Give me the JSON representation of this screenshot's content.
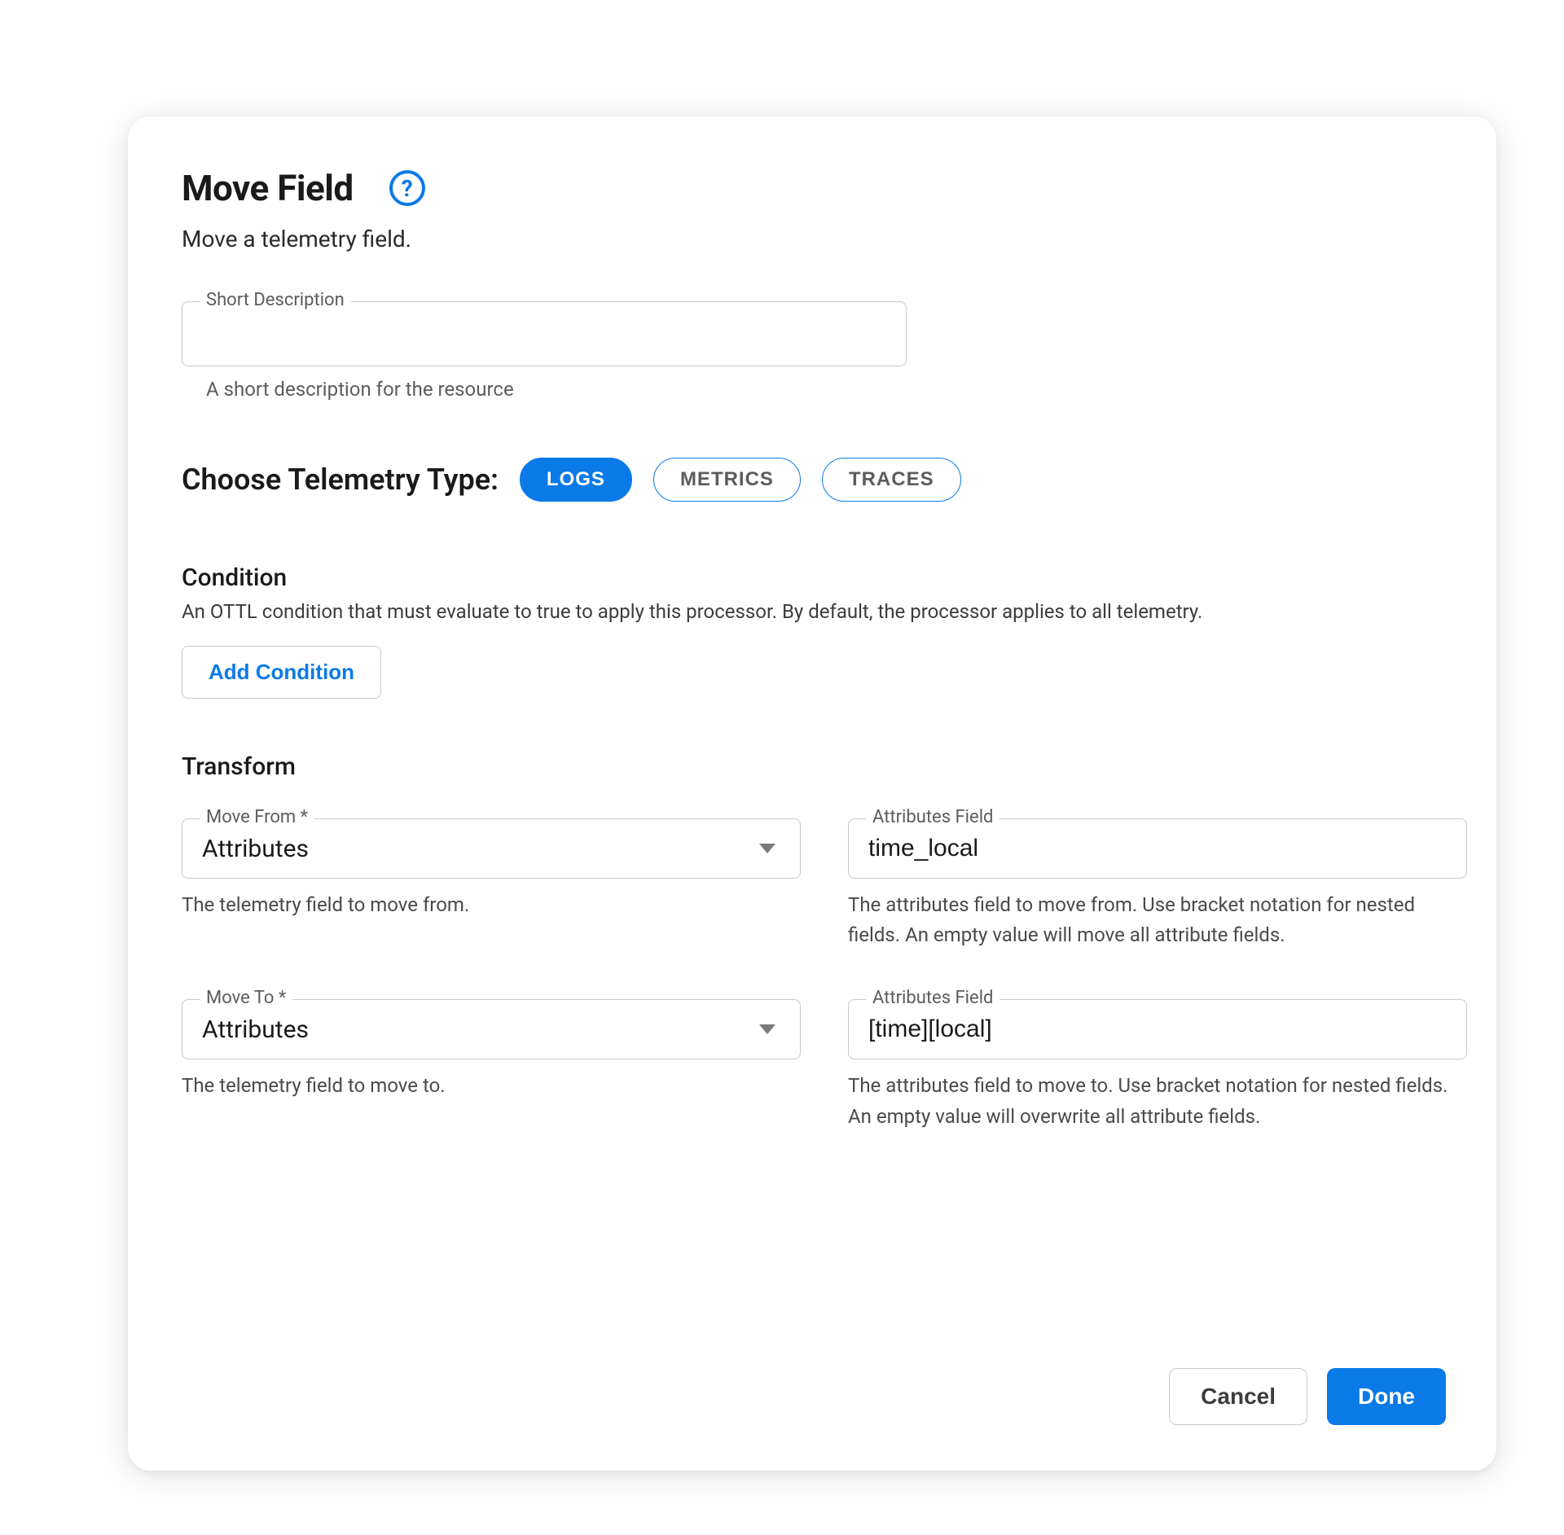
{
  "dialog": {
    "title": "Move Field",
    "subtitle": "Move a telemetry field.",
    "help_icon": "?"
  },
  "shortDescription": {
    "label": "Short Description",
    "value": "",
    "helper": "A short description for the resource"
  },
  "telemetryType": {
    "label": "Choose Telemetry Type:",
    "options": {
      "logs": "LOGS",
      "metrics": "METRICS",
      "traces": "TRACES"
    },
    "active": "logs"
  },
  "condition": {
    "title": "Condition",
    "description": "An OTTL condition that must evaluate to true to apply this processor. By default, the processor applies to all telemetry.",
    "addButton": "Add Condition"
  },
  "transform": {
    "title": "Transform",
    "moveFrom": {
      "label": "Move From *",
      "value": "Attributes",
      "helper": "The telemetry field to move from."
    },
    "attrFrom": {
      "label": "Attributes Field",
      "value": "time_local",
      "helper": "The attributes field to move from. Use bracket notation for nested fields. An empty value will move all attribute fields."
    },
    "moveTo": {
      "label": "Move To *",
      "value": "Attributes",
      "helper": "The telemetry field to move to."
    },
    "attrTo": {
      "label": "Attributes Field",
      "value": "[time][local]",
      "helper": "The attributes field to move to. Use bracket notation for nested fields. An empty value will overwrite all attribute fields."
    }
  },
  "footer": {
    "cancel": "Cancel",
    "done": "Done"
  },
  "colors": {
    "accent": "#0a7ae8",
    "border": "#c9c9c9",
    "text": "#1a1a1a",
    "muted": "#5c5c5c"
  }
}
